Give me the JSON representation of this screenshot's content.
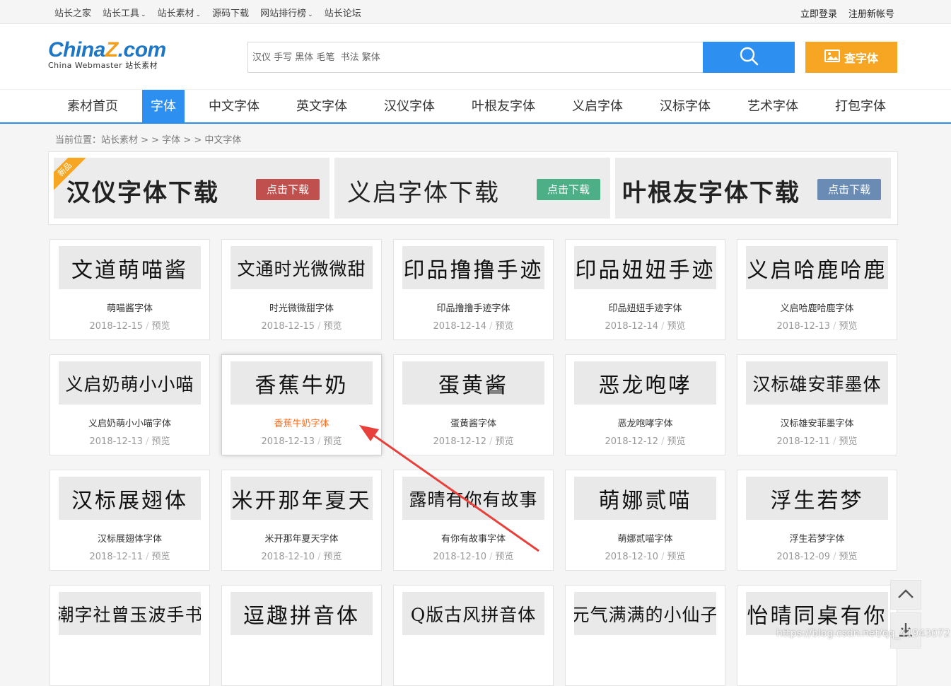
{
  "topbar": {
    "links": [
      {
        "label": "站长之家",
        "caret": false
      },
      {
        "label": "站长工具",
        "caret": true
      },
      {
        "label": "站长素材",
        "caret": true
      },
      {
        "label": "源码下载",
        "caret": false
      },
      {
        "label": "网站排行榜",
        "caret": true
      },
      {
        "label": "站长论坛",
        "caret": false
      }
    ],
    "login": "立即登录",
    "register": "注册新帐号"
  },
  "logo": {
    "main_a": "China",
    "main_z": "Z",
    "main_b": ".com",
    "sub": "China Webmaster 站长素材"
  },
  "search": {
    "placeholder": "汉仪 手写 黑体 毛笔  书法 繁体",
    "find_label": "查字体"
  },
  "nav": [
    "素材首页",
    "字体",
    "中文字体",
    "英文字体",
    "汉仪字体",
    "叶根友字体",
    "义启字体",
    "汉标字体",
    "艺术字体",
    "打包字体"
  ],
  "nav_active": 1,
  "breadcrumb": "当前位置：站长素材 > > 字体 > > 中文字体",
  "banners": [
    {
      "title": "汉仪字体下载",
      "button": "点击下载",
      "badge": "新品",
      "btn_color": "#c0504d"
    },
    {
      "title": "义启字体下载",
      "button": "点击下载",
      "badge": "",
      "btn_color": "#4caf85"
    },
    {
      "title": "叶根友字体下载",
      "button": "点击下载",
      "badge": "",
      "btn_color": "#6a8bb3"
    }
  ],
  "fonts": [
    {
      "preview": "文道萌喵酱",
      "name": "萌喵酱字体",
      "date": "2018-12-15",
      "action": "预览"
    },
    {
      "preview": "文通时光微微甜",
      "name": "时光微微甜字体",
      "date": "2018-12-15",
      "action": "预览"
    },
    {
      "preview": "印品撸撸手迹",
      "name": "印品撸撸手迹字体",
      "date": "2018-12-14",
      "action": "预览"
    },
    {
      "preview": "印品妞妞手迹",
      "name": "印品妞妞手迹字体",
      "date": "2018-12-14",
      "action": "预览"
    },
    {
      "preview": "义启哈鹿哈鹿",
      "name": "义启哈鹿哈鹿字体",
      "date": "2018-12-13",
      "action": "预览"
    },
    {
      "preview": "义启奶萌小小喵",
      "name": "义启奶萌小小喵字体",
      "date": "2018-12-13",
      "action": "预览"
    },
    {
      "preview": "香蕉牛奶",
      "name": "香蕉牛奶字体",
      "date": "2018-12-13",
      "action": "预览"
    },
    {
      "preview": "蛋黄酱",
      "name": "蛋黄酱字体",
      "date": "2018-12-12",
      "action": "预览"
    },
    {
      "preview": "恶龙咆哮",
      "name": "恶龙咆哮字体",
      "date": "2018-12-12",
      "action": "预览"
    },
    {
      "preview": "汉标雄安菲墨体",
      "name": "汉标雄安菲墨字体",
      "date": "2018-12-11",
      "action": "预览"
    },
    {
      "preview": "汉标展翅体",
      "name": "汉标展翅体字体",
      "date": "2018-12-11",
      "action": "预览"
    },
    {
      "preview": "米开那年夏天",
      "name": "米开那年夏天字体",
      "date": "2018-12-10",
      "action": "预览"
    },
    {
      "preview": "露晴有你有故事",
      "name": "有你有故事字体",
      "date": "2018-12-10",
      "action": "预览"
    },
    {
      "preview": "萌娜贰喵",
      "name": "萌娜贰喵字体",
      "date": "2018-12-10",
      "action": "预览"
    },
    {
      "preview": "浮生若梦",
      "name": "浮生若梦字体",
      "date": "2018-12-09",
      "action": "预览"
    },
    {
      "preview": "潮字社曾玉波手书",
      "name": "",
      "date": "",
      "action": ""
    },
    {
      "preview": "逗趣拼音体",
      "name": "",
      "date": "",
      "action": ""
    },
    {
      "preview": "Q版古风拼音体",
      "name": "",
      "date": "",
      "action": ""
    },
    {
      "preview": "元气满满的小仙子",
      "name": "",
      "date": "",
      "action": ""
    },
    {
      "preview": "怡晴同桌有你",
      "name": "",
      "date": "",
      "action": ""
    }
  ],
  "hover_index": 6,
  "watermark": "https://blog.csdn.net/qq_41943072",
  "colors": {
    "accent": "#2d8ff0",
    "orange": "#f6a623",
    "highlight": "#ff6b1a",
    "arrow": "#e8403a"
  }
}
